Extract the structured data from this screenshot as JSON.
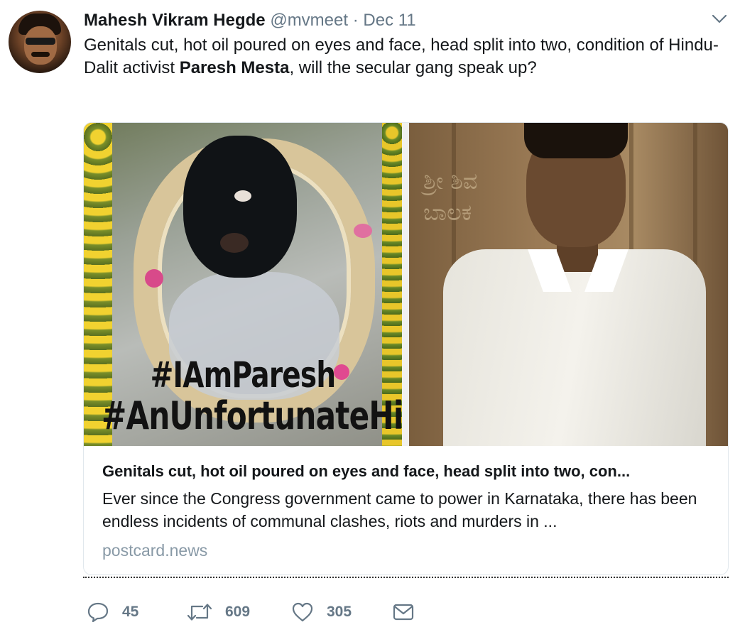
{
  "tweet": {
    "author_name": "Mahesh Vikram Hegde",
    "handle": "@mvmeet",
    "separator": "·",
    "date": "Dec 11",
    "text_part1": "Genitals cut, hot oil poured on eyes and face, head split into two, condition of Hindu-Dalit activist ",
    "text_bold": "Paresh Mesta",
    "text_part2": ", will the secular gang speak up?"
  },
  "card": {
    "image_left_hashtag1": "#IAmParesh",
    "image_left_hashtag2": "#AnUnfortunateHindu",
    "image_right_wall_text_line1": "ಶ್ರೀ ಶಿವ",
    "image_right_wall_text_line2": "ಬಾಲಕ",
    "title": "Genitals cut, hot oil poured on eyes and face, head split into two, con...",
    "description": "Ever since the Congress government came to power in Karnataka, there has been endless incidents of communal clashes, riots and murders in ...",
    "domain": "postcard.news"
  },
  "actions": {
    "replies": "45",
    "retweets": "609",
    "likes": "305"
  },
  "icons": {
    "caret": "chevron-down-icon",
    "reply": "reply-icon",
    "retweet": "retweet-icon",
    "like": "heart-icon",
    "message": "envelope-icon"
  },
  "colors": {
    "text": "#14171a",
    "secondary": "#657786",
    "domain": "#8899a6",
    "border": "#e1e8ed"
  }
}
